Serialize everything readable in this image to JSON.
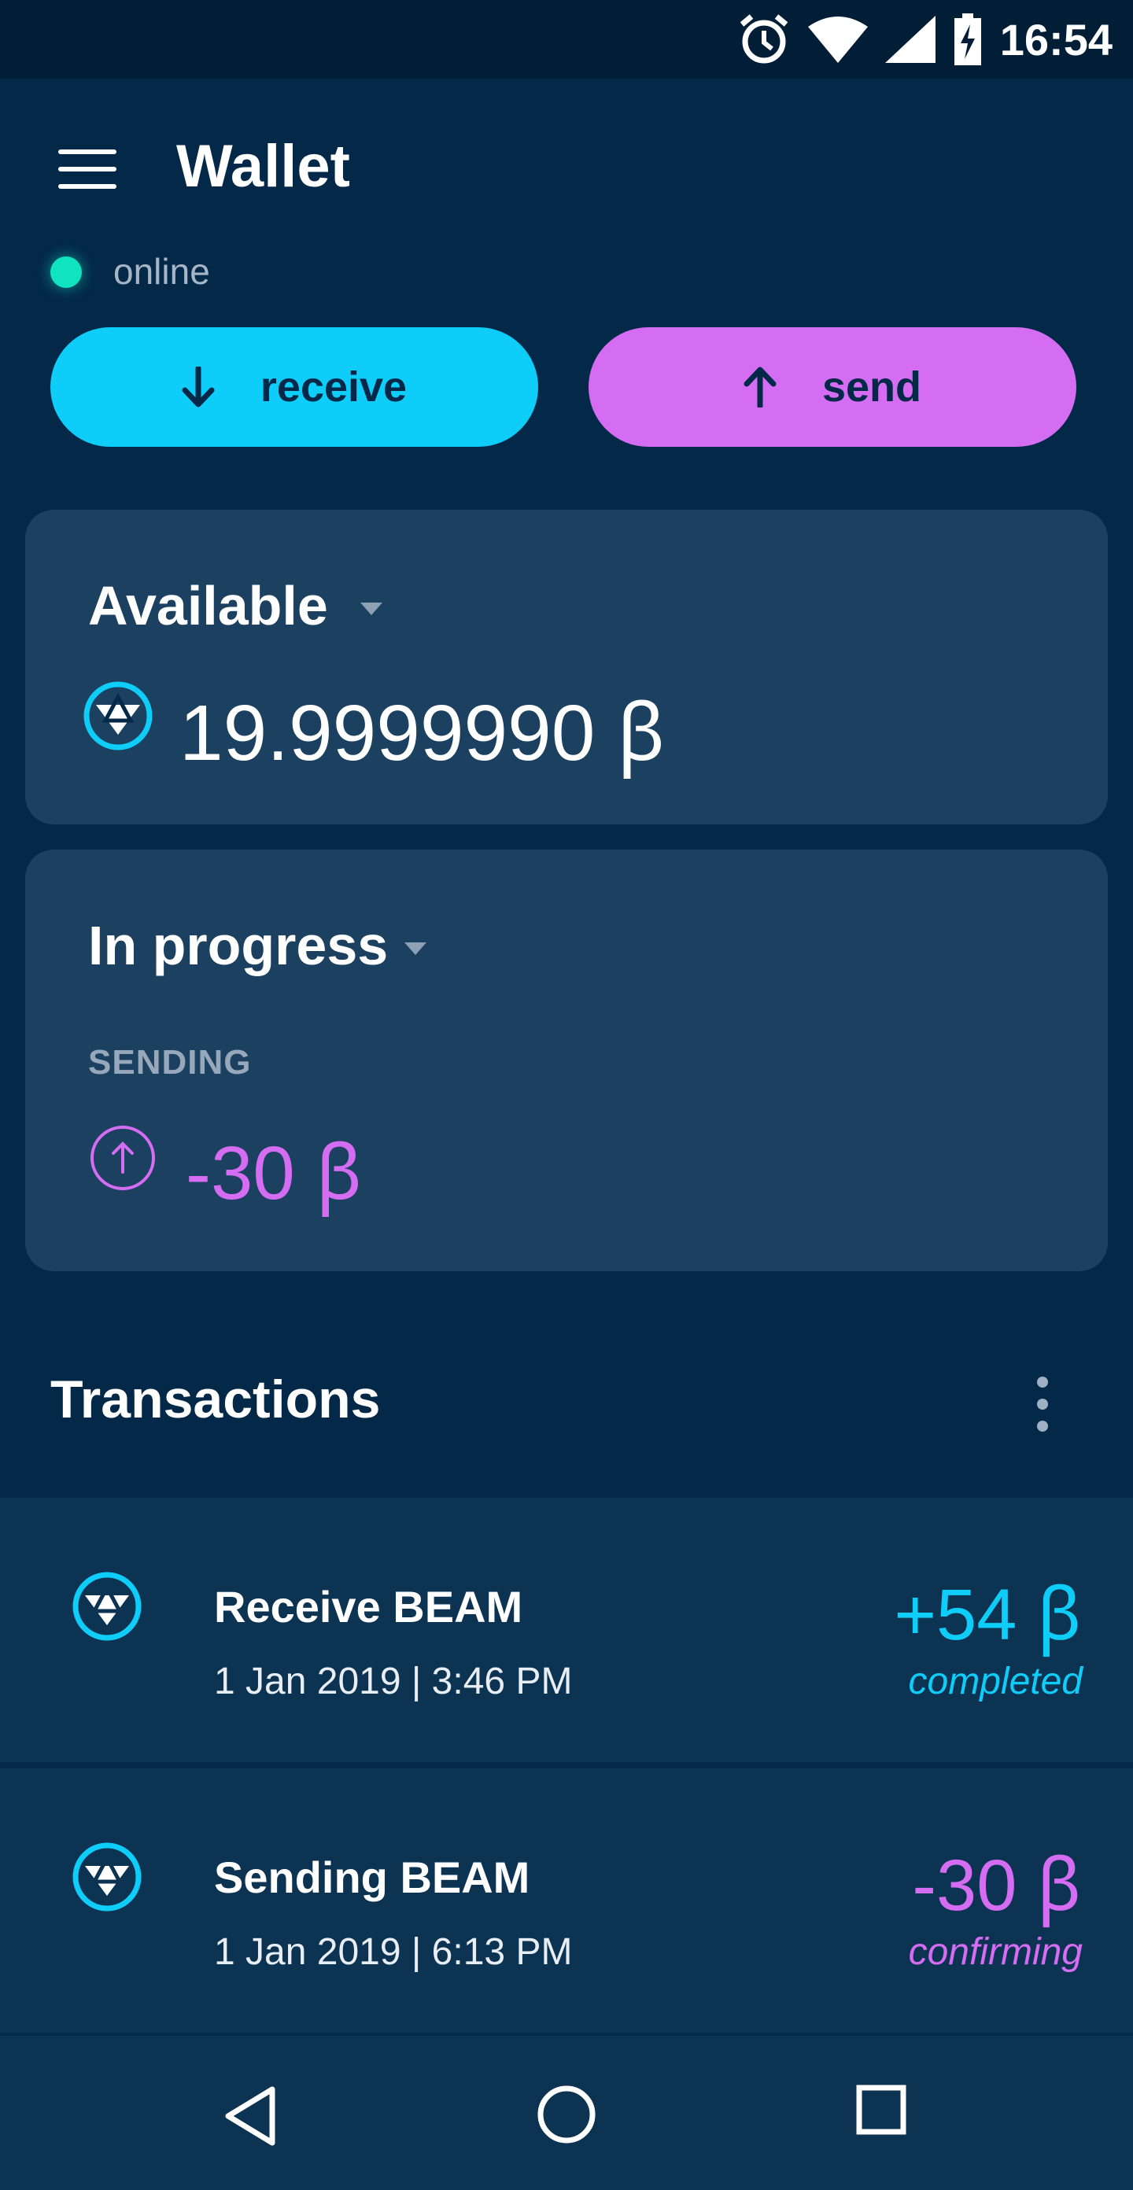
{
  "status_bar": {
    "time": "16:54",
    "icons": [
      "alarm-icon",
      "wifi-icon",
      "signal-icon",
      "battery-charging-icon"
    ]
  },
  "header": {
    "title": "Wallet",
    "menu_icon": "menu-icon"
  },
  "connection": {
    "status": "online",
    "color": "#0fe3c0"
  },
  "actions": {
    "receive_label": "receive",
    "send_label": "send",
    "receive_color": "#0ecdf8",
    "send_color": "#d56df2"
  },
  "available": {
    "title": "Available",
    "amount": "19.9999990 ꞵ"
  },
  "in_progress": {
    "title": "In progress",
    "section_label": "SENDING",
    "amount": "-30 ꞵ"
  },
  "transactions": {
    "header": "Transactions",
    "items": [
      {
        "title": "Receive BEAM",
        "date": "1 Jan 2019  |  3:46 PM",
        "amount": "+54 ꞵ",
        "status": "completed",
        "color": "#0ecdf8"
      },
      {
        "title": "Sending BEAM",
        "date": "1 Jan 2019  |  6:13 PM",
        "amount": "-30 ꞵ",
        "status": "confirming",
        "color": "#d56df2"
      }
    ]
  },
  "nav": {
    "icons": [
      "back-icon",
      "home-icon",
      "recents-icon"
    ]
  }
}
